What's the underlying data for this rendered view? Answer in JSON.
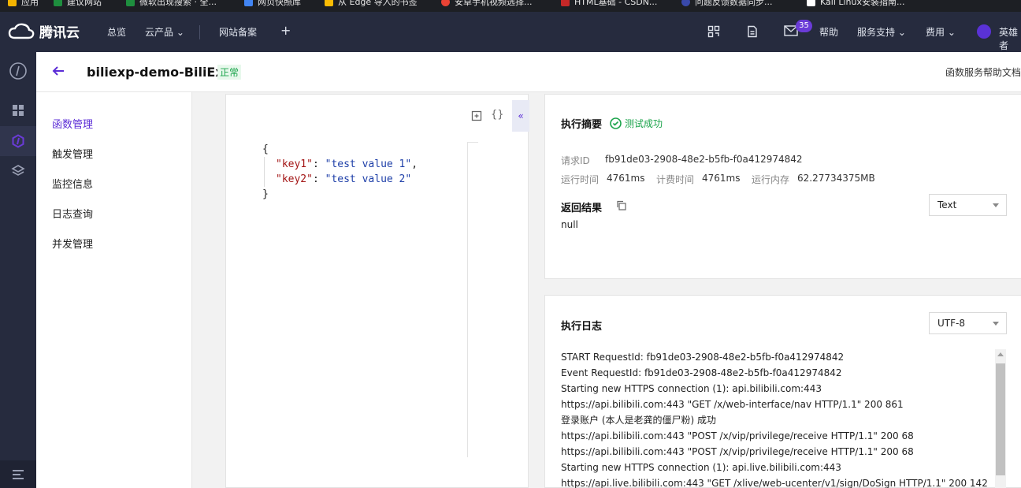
{
  "bookmarks": [
    {
      "label": "应用",
      "color": "#f4b400"
    },
    {
      "label": "建议网站",
      "color": "#1e8e3e"
    },
    {
      "label": "微软出现搜索 · 全...",
      "color": "#1e8e3e"
    },
    {
      "label": "网页快照库",
      "color": "#4285f4"
    },
    {
      "label": "从 Edge 导入的书签",
      "color": "#fbbc04"
    },
    {
      "label": "安卓手机视频选择...",
      "color": "#ea4335"
    },
    {
      "label": "HTML基础 - CSDN...",
      "color": "#c62828"
    },
    {
      "label": "问题反馈数据同步...",
      "color": "#3949ab"
    },
    {
      "label": "Kali Linux安装指南...",
      "color": "#ffffff"
    }
  ],
  "topnav": {
    "brand": "腾讯云",
    "items": [
      "总览",
      "云产品",
      "网站备案"
    ],
    "right": {
      "badge_count": "35",
      "help": "帮助",
      "service": "服务支持",
      "billing": "费用",
      "user": "英雄者"
    }
  },
  "header": {
    "function_name": "biliexp-demo-BiliExp",
    "status": "正常",
    "help_link": "函数服务帮助文档"
  },
  "sidemenu": {
    "items": [
      "函数管理",
      "触发管理",
      "监控信息",
      "日志查询",
      "并发管理"
    ]
  },
  "editor": {
    "open_brace": "{",
    "close_brace": "}",
    "line1_key": "\"key1\"",
    "line1_val": "\"test value 1\"",
    "line2_key": "\"key2\"",
    "line2_val": "\"test value 2\""
  },
  "summary": {
    "title": "执行摘要",
    "result_status": "测试成功",
    "request_id_label": "请求ID",
    "request_id": "fb91de03-2908-48e2-b5fb-f0a412974842",
    "run_time_label": "运行时间",
    "run_time": "4761ms",
    "billing_time_label": "计费时间",
    "billing_time": "4761ms",
    "memory_label": "运行内存",
    "memory": "62.27734375MB",
    "return_title": "返回结果",
    "return_format": "Text",
    "return_value": "null"
  },
  "log": {
    "title": "执行日志",
    "encoding": "UTF-8",
    "lines": [
      "START RequestId: fb91de03-2908-48e2-b5fb-f0a412974842",
      "Event RequestId: fb91de03-2908-48e2-b5fb-f0a412974842",
      "Starting new HTTPS connection (1): api.bilibili.com:443",
      "https://api.bilibili.com:443 \"GET /x/web-interface/nav HTTP/1.1\" 200 861",
      "登录账户 (本人是老龚的僵尸粉) 成功",
      "https://api.bilibili.com:443 \"POST /x/vip/privilege/receive HTTP/1.1\" 200 68",
      "https://api.bilibili.com:443 \"POST /x/vip/privilege/receive HTTP/1.1\" 200 68",
      "Starting new HTTPS connection (1): api.live.bilibili.com:443",
      "https://api.live.bilibili.com:443 \"GET /xlive/web-ucenter/v1/sign/DoSign HTTP/1.1\" 200 142"
    ]
  },
  "colors": {
    "accent": "#5b2cd6",
    "success": "#1aa34a",
    "nav_bg": "#262b3e"
  }
}
